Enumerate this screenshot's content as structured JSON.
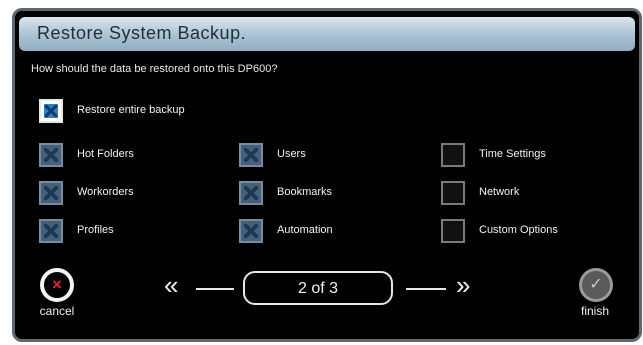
{
  "dialog": {
    "title": "Restore System Backup.",
    "prompt": "How should the data be restored onto this DP600?"
  },
  "options": {
    "restore_entire": "Restore entire backup",
    "hot_folders": "Hot Folders",
    "workorders": "Workorders",
    "profiles": "Profiles",
    "users": "Users",
    "bookmarks": "Bookmarks",
    "automation": "Automation",
    "time_settings": "Time Settings",
    "network": "Network",
    "custom_options": "Custom Options"
  },
  "checked": {
    "restore_entire": true,
    "hot_folders": true,
    "workorders": true,
    "profiles": true,
    "users": true,
    "bookmarks": true,
    "automation": true,
    "time_settings": false,
    "network": false,
    "custom_options": false
  },
  "nav": {
    "page": "2 of 3",
    "prev_icon": "double-chevron-left",
    "next_icon": "double-chevron-right"
  },
  "buttons": {
    "cancel": "cancel",
    "finish": "finish"
  },
  "icons": {
    "cancel": "x-circle-icon",
    "finish": "check-circle-icon"
  },
  "colors": {
    "title_bar": "#a9c1d2",
    "checkbox_fill": "#2e7fc2",
    "cancel_x": "#e8212f"
  }
}
